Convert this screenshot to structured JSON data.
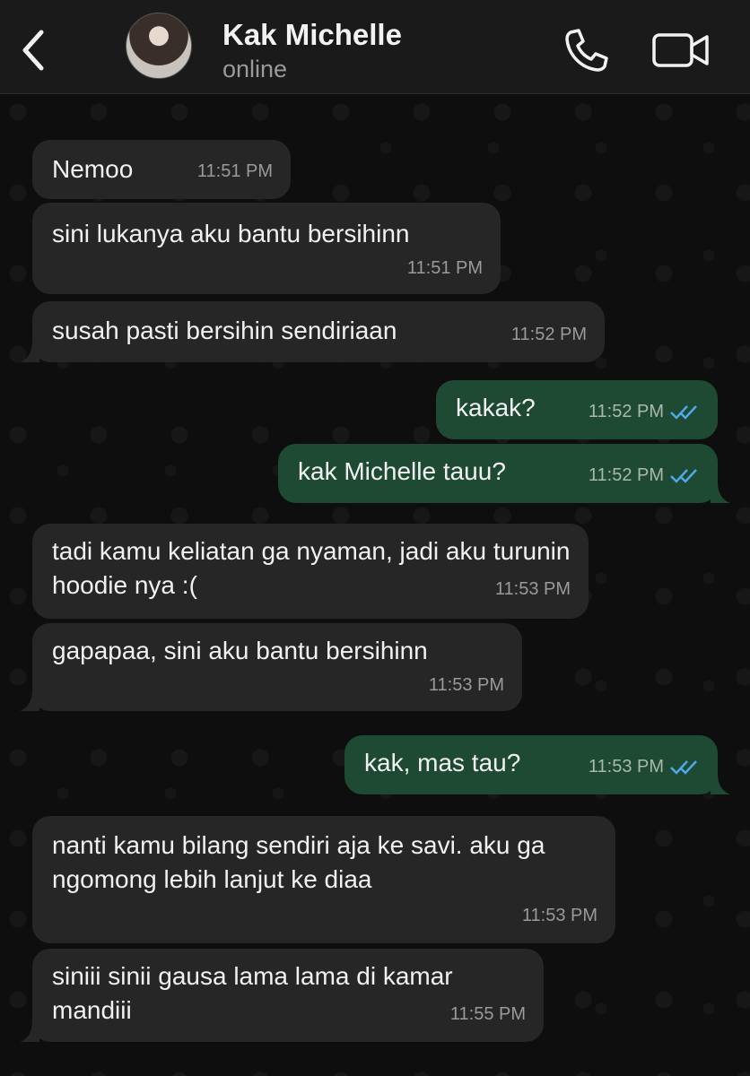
{
  "header": {
    "back_label": "back",
    "contact_name": "Kak Michelle",
    "status": "online"
  },
  "colors": {
    "incoming_bubble": "#262626",
    "outgoing_bubble": "#1e4a33",
    "read_ticks": "#4fa8e8"
  },
  "icons": {
    "back": "chevron-left-icon",
    "call": "phone-icon",
    "video": "video-camera-icon",
    "read": "double-check-icon"
  },
  "messages": [
    {
      "text": "Nemoo",
      "time": "11:51 PM",
      "direction": "incoming"
    },
    {
      "text": "sini lukanya aku bantu bersihinn",
      "time": "11:51 PM",
      "direction": "incoming"
    },
    {
      "text": "susah pasti bersihin sendiriaan",
      "time": "11:52 PM",
      "direction": "incoming"
    },
    {
      "text": "kakak?",
      "time": "11:52 PM",
      "direction": "outgoing",
      "read": true
    },
    {
      "text": "kak Michelle tauu?",
      "time": "11:52 PM",
      "direction": "outgoing",
      "read": true
    },
    {
      "text": "tadi kamu keliatan ga nyaman, jadi aku turunin hoodie nya :(",
      "time": "11:53 PM",
      "direction": "incoming"
    },
    {
      "text": "gapapaa, sini aku bantu bersihinn",
      "time": "11:53 PM",
      "direction": "incoming"
    },
    {
      "text": "kak, mas tau?",
      "time": "11:53 PM",
      "direction": "outgoing",
      "read": true
    },
    {
      "text": "nanti kamu bilang sendiri aja ke savi. aku ga ngomong lebih lanjut ke diaa",
      "time": "11:53 PM",
      "direction": "incoming"
    },
    {
      "text": "siniii sinii gausa lama lama di kamar mandiii",
      "time": "11:55 PM",
      "direction": "incoming"
    }
  ]
}
